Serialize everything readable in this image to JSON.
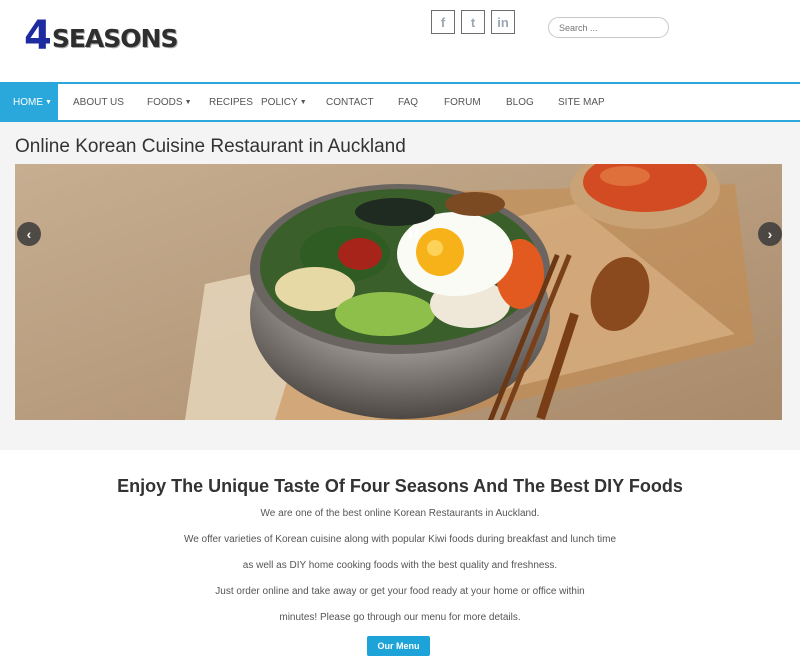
{
  "brand": {
    "logo_number": "4",
    "logo_word": "SEASONS"
  },
  "social": [
    {
      "icon": "facebook-icon",
      "glyph": "f"
    },
    {
      "icon": "twitter-icon",
      "glyph": "t"
    },
    {
      "icon": "linkedin-icon",
      "glyph": "in"
    }
  ],
  "search": {
    "placeholder": "Search ..."
  },
  "nav": {
    "items": [
      {
        "label": "HOME",
        "dropdown": true,
        "active": true
      },
      {
        "label": "ABOUT US",
        "dropdown": false
      },
      {
        "label": "FOODS",
        "dropdown": true
      },
      {
        "label": "RECIPES",
        "dropdown": false
      },
      {
        "label": "POLICY",
        "dropdown": true
      },
      {
        "label": "CONTACT",
        "dropdown": false
      },
      {
        "label": "FAQ",
        "dropdown": false
      },
      {
        "label": "FORUM",
        "dropdown": false
      },
      {
        "label": "BLOG",
        "dropdown": false
      },
      {
        "label": "SITE MAP",
        "dropdown": false
      }
    ],
    "accent": "#2aa8db"
  },
  "hero": {
    "title": "Online Korean Cuisine Restaurant in Auckland",
    "prev_glyph": "‹",
    "next_glyph": "›"
  },
  "content": {
    "heading": "Enjoy The Unique Taste Of Four Seasons And The Best DIY Foods",
    "lines": [
      "We are one of the best online Korean Restaurants in Auckland.",
      "We offer varieties of Korean cuisine along with popular Kiwi foods during breakfast and lunch time",
      "as well as DIY home cooking foods with the best quality and freshness.",
      "Just order online and take away or get your food ready at your home or office within",
      "minutes! Please go through our menu for more details."
    ],
    "button_label": "Our Menu",
    "button_color": "#1ea3d8"
  }
}
